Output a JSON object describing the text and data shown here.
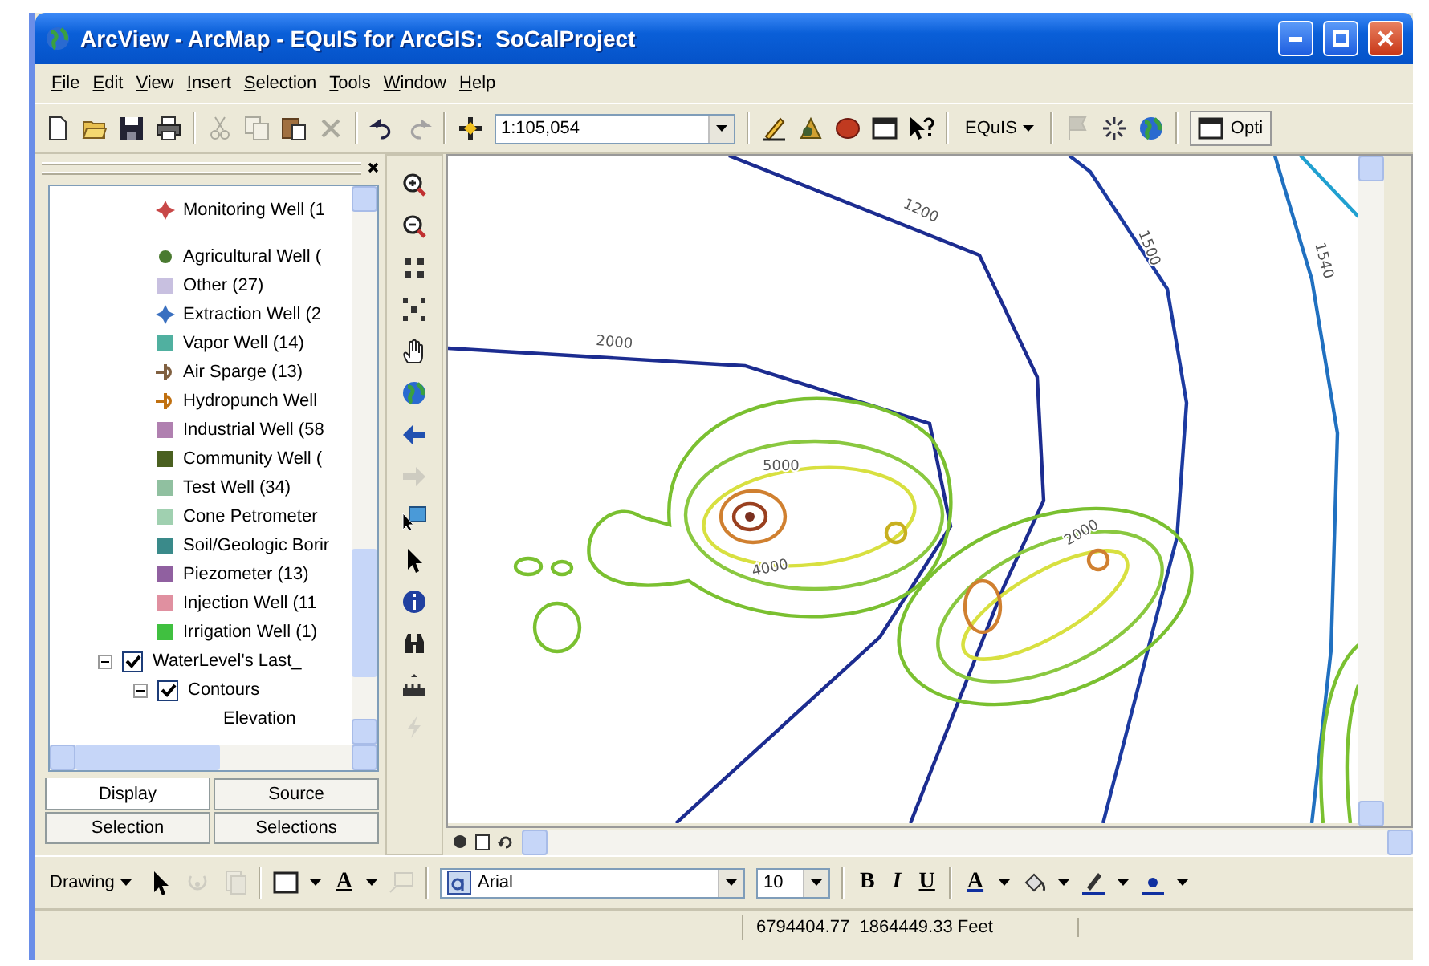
{
  "window": {
    "title": "ArcView - ArcMap - EQuIS for ArcGIS:  SoCalProject"
  },
  "menu": [
    "File",
    "Edit",
    "View",
    "Insert",
    "Selection",
    "Tools",
    "Window",
    "Help"
  ],
  "toolbar": [
    {
      "kind": "new",
      "disabled": false
    },
    {
      "kind": "open",
      "disabled": false
    },
    {
      "kind": "save",
      "disabled": false
    },
    {
      "kind": "print",
      "disabled": false
    },
    {
      "kind": "sep"
    },
    {
      "kind": "cut",
      "disabled": true
    },
    {
      "kind": "copy",
      "disabled": true
    },
    {
      "kind": "paste",
      "disabled": false
    },
    {
      "kind": "delete",
      "disabled": true
    },
    {
      "kind": "sep"
    },
    {
      "kind": "undo",
      "disabled": false
    },
    {
      "kind": "redo",
      "disabled": true
    },
    {
      "kind": "sep"
    },
    {
      "kind": "adddata",
      "disabled": false
    },
    {
      "kind": "scale-combo",
      "value": "1:105,054",
      "disabled": false
    },
    {
      "kind": "sep"
    },
    {
      "kind": "editor",
      "disabled": false
    },
    {
      "kind": "pyramid",
      "disabled": false
    },
    {
      "kind": "ball",
      "disabled": false
    },
    {
      "kind": "window",
      "disabled": false
    },
    {
      "kind": "help",
      "disabled": false
    },
    {
      "kind": "sep"
    },
    {
      "kind": "menu",
      "label": "EQuIS",
      "disabled": false
    },
    {
      "kind": "sep"
    },
    {
      "kind": "flag",
      "disabled": true
    },
    {
      "kind": "sparkle",
      "disabled": false
    },
    {
      "kind": "globe",
      "disabled": false
    },
    {
      "kind": "sep"
    },
    {
      "kind": "options",
      "label": "Opti",
      "disabled": false
    }
  ],
  "toc": {
    "legend": [
      {
        "label": "Monitoring Well (1",
        "kind": "cross",
        "color": "#c84848"
      },
      {
        "label": "Agricultural Well (",
        "kind": "dot",
        "color": "#4a7a30"
      },
      {
        "label": "Other (27)",
        "kind": "square",
        "color": "#c8c0e0"
      },
      {
        "label": "Extraction Well (2",
        "kind": "cross",
        "color": "#3a70c0"
      },
      {
        "label": "Vapor Well (14)",
        "kind": "square",
        "color": "#50b0a0"
      },
      {
        "label": "Air Sparge (13)",
        "kind": "pin",
        "color": "#806040"
      },
      {
        "label": "Hydropunch Well",
        "kind": "pin",
        "color": "#c07010"
      },
      {
        "label": "Industrial Well (58",
        "kind": "square",
        "color": "#b080b0"
      },
      {
        "label": "Community Well (",
        "kind": "square",
        "color": "#4a6020"
      },
      {
        "label": "Test Well (34)",
        "kind": "square",
        "color": "#90c0a0"
      },
      {
        "label": "Cone Petrometer",
        "kind": "square",
        "color": "#a0d0b0"
      },
      {
        "label": "Soil/Geologic Borir",
        "kind": "square",
        "color": "#3a8a8a"
      },
      {
        "label": "Piezometer (13)",
        "kind": "square",
        "color": "#9060a0"
      },
      {
        "label": "Injection Well (11",
        "kind": "square",
        "color": "#e090a0"
      },
      {
        "label": "Irrigation Well (1)",
        "kind": "square",
        "color": "#40c040"
      }
    ],
    "layers": [
      {
        "label": "WaterLevel's Last_",
        "checked": true,
        "expanded": true,
        "children": [
          {
            "label": "Contours",
            "checked": true,
            "expanded": true,
            "children": [
              {
                "label": "Elevation"
              }
            ]
          }
        ]
      }
    ],
    "tabs": [
      {
        "label": "Display",
        "selected": true
      },
      {
        "label": "Source",
        "selected": false
      },
      {
        "label": "Selection",
        "selected": false
      },
      {
        "label": "Selections",
        "selected": false
      }
    ]
  },
  "tools": [
    {
      "kind": "zoomin",
      "disabled": false
    },
    {
      "kind": "zoomout",
      "disabled": false
    },
    {
      "kind": "fixin",
      "disabled": false
    },
    {
      "kind": "fixout",
      "disabled": false
    },
    {
      "kind": "pan",
      "disabled": false
    },
    {
      "kind": "globe",
      "disabled": false
    },
    {
      "kind": "back",
      "disabled": false
    },
    {
      "kind": "fwd",
      "disabled": true
    },
    {
      "kind": "selfeat",
      "disabled": false
    },
    {
      "kind": "pointer",
      "disabled": false
    },
    {
      "kind": "identify",
      "disabled": false
    },
    {
      "kind": "find",
      "disabled": false
    },
    {
      "kind": "measure",
      "disabled": false
    },
    {
      "kind": "bolt",
      "disabled": true
    }
  ],
  "map": {
    "contour_labels": [
      "1200",
      "1500",
      "1540",
      "2000",
      "5000",
      "4000",
      "2000"
    ]
  },
  "drawing_toolbar": [
    {
      "kind": "menu",
      "label": "Drawing",
      "disabled": false
    },
    {
      "kind": "pointer",
      "disabled": false
    },
    {
      "kind": "rotate",
      "disabled": true
    },
    {
      "kind": "zoomsel",
      "disabled": true
    },
    {
      "kind": "sep"
    },
    {
      "kind": "rect",
      "disabled": false
    },
    {
      "kind": "caret",
      "disabled": false
    },
    {
      "kind": "text-tool",
      "label": "A",
      "disabled": false
    },
    {
      "kind": "caret",
      "disabled": false
    },
    {
      "kind": "callout",
      "disabled": true
    },
    {
      "kind": "sep"
    },
    {
      "kind": "font-combo",
      "value": "Arial",
      "disabled": false
    },
    {
      "kind": "size-combo",
      "value": "10",
      "disabled": false
    },
    {
      "kind": "sep"
    },
    {
      "kind": "bold",
      "label": "B",
      "disabled": false
    },
    {
      "kind": "italic",
      "label": "I",
      "disabled": false
    },
    {
      "kind": "underline",
      "label": "U",
      "disabled": false
    },
    {
      "kind": "sep"
    },
    {
      "kind": "font-color",
      "label": "A",
      "disabled": false
    },
    {
      "kind": "caret",
      "disabled": false
    },
    {
      "kind": "fill",
      "disabled": false
    },
    {
      "kind": "caret",
      "disabled": false
    },
    {
      "kind": "linecolor",
      "disabled": false
    },
    {
      "kind": "caret",
      "disabled": false
    },
    {
      "kind": "marker",
      "disabled": false
    },
    {
      "kind": "caret",
      "disabled": false
    }
  ],
  "status_bar": {
    "coordinates": "6794404.77  1864449.33 Feet"
  }
}
